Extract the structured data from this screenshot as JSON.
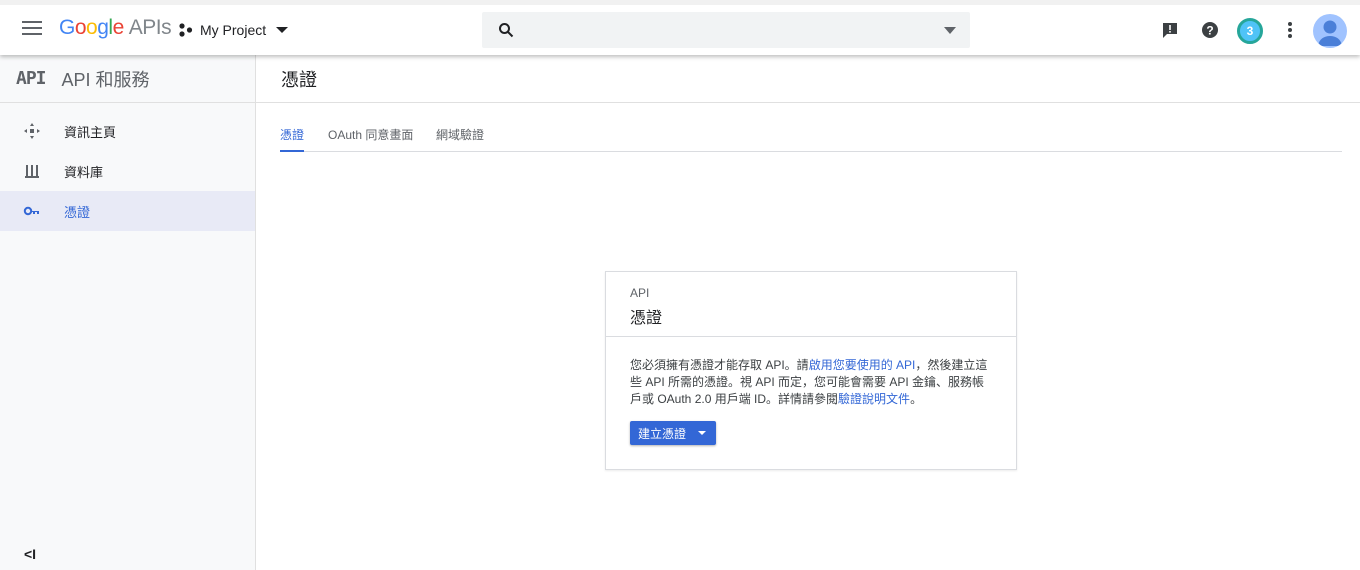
{
  "header": {
    "logo_google": [
      "G",
      "o",
      "o",
      "g",
      "l",
      "e"
    ],
    "logo_suffix": "APIs",
    "project_name": "My Project",
    "search_placeholder": "",
    "notification_count": "3"
  },
  "sidebar": {
    "api_logo": "API",
    "title": "API 和服務",
    "items": [
      {
        "label": "資訊主頁",
        "icon": "dashboard-icon"
      },
      {
        "label": "資料庫",
        "icon": "library-icon"
      },
      {
        "label": "憑證",
        "icon": "key-icon",
        "active": true
      }
    ],
    "collapse_label": "<I"
  },
  "main": {
    "page_title": "憑證",
    "tabs": [
      {
        "label": "憑證",
        "active": true
      },
      {
        "label": "OAuth 同意畫面"
      },
      {
        "label": "網域驗證"
      }
    ],
    "card": {
      "kicker": "API",
      "title": "憑證",
      "text_1": "您必須擁有憑證才能存取 API。請",
      "link_1": "啟用您要使用的 API",
      "text_2": "，然後建立這些 API 所需的憑證。視 API 而定，您可能會需要 API 金鑰、服務帳戶或 OAuth 2.0 用戶端 ID。詳情請參閱",
      "link_2": "驗證說明文件",
      "text_3": "。",
      "button_label": "建立憑證"
    }
  },
  "colors": {
    "accent": "#3367d6",
    "sidebar_bg": "#f8f9fa",
    "active_item_bg": "#e8eaf6"
  }
}
